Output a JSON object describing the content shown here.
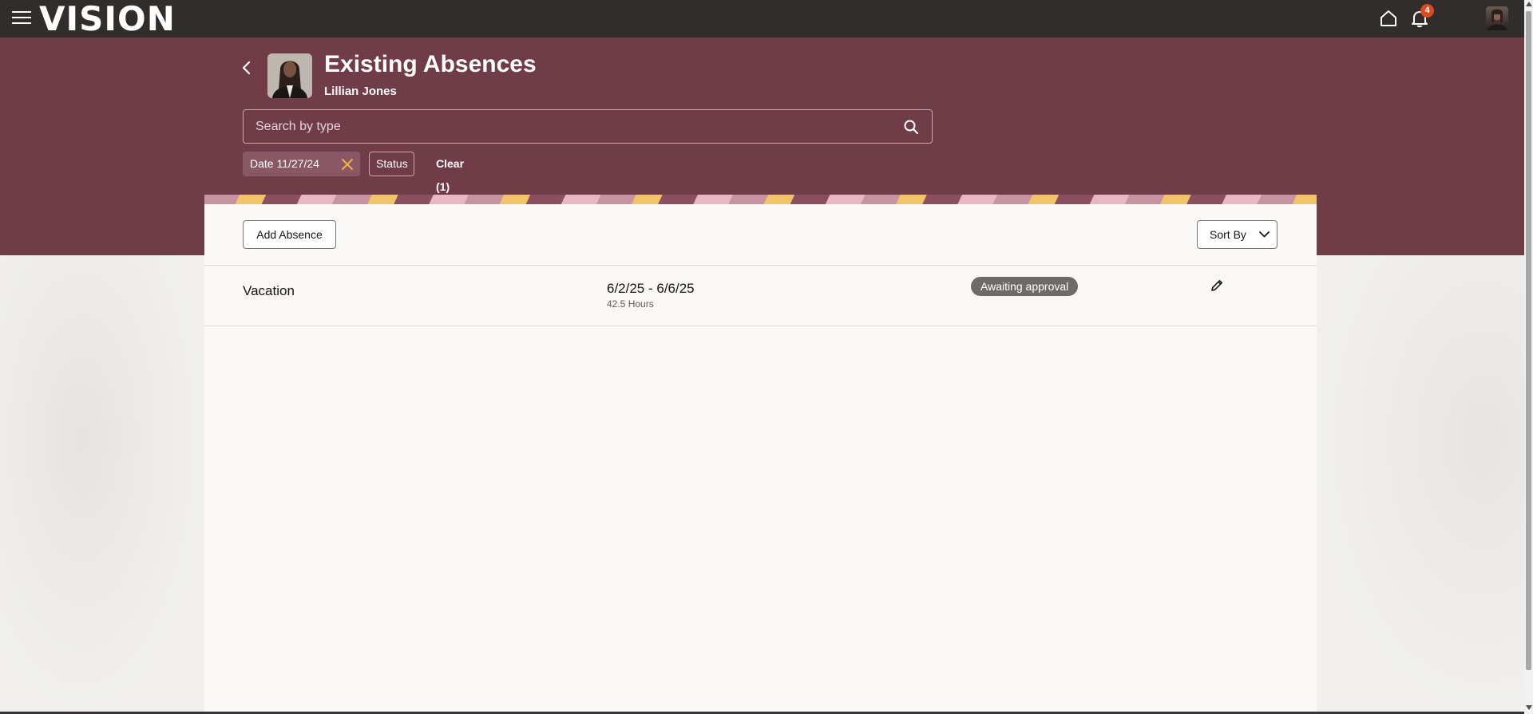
{
  "app": {
    "logo": "VISION",
    "notifications_count": "4"
  },
  "header": {
    "title": "Existing Absences",
    "person_name": "Lillian Jones"
  },
  "search": {
    "placeholder": "Search by type",
    "value": ""
  },
  "filters": {
    "date_chip": "Date 11/27/24",
    "status_chip": "Status",
    "clear_label": "Clear (1)"
  },
  "toolbar": {
    "add_label": "Add Absence",
    "sort_label": "Sort By"
  },
  "absences": [
    {
      "type": "Vacation",
      "dates": "6/2/25 - 6/6/25",
      "hours": "42.5 Hours",
      "status": "Awaiting approval"
    }
  ],
  "colors": {
    "topbar": "#312d2a",
    "band": "#6f3c48",
    "badge": "#d94b1e",
    "status_badge": "#6f6a66"
  }
}
